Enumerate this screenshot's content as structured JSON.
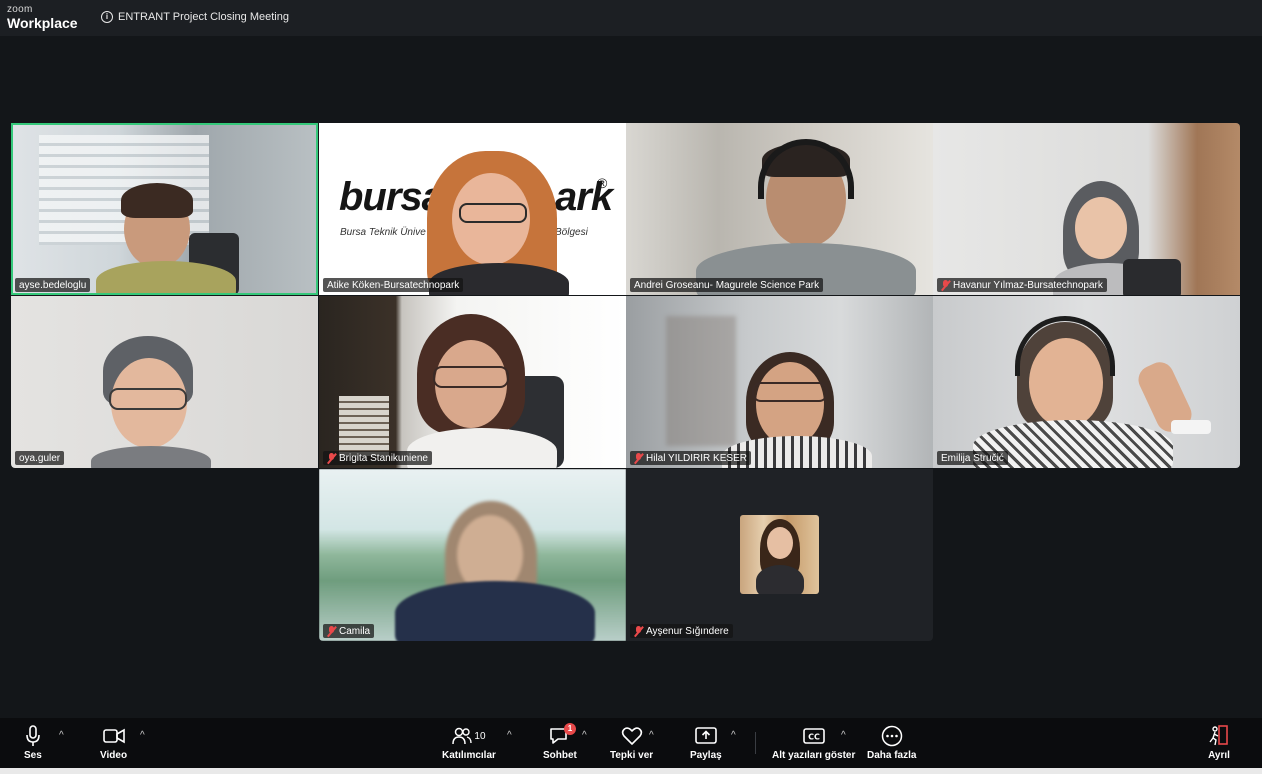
{
  "app": {
    "brand_line1": "zoom",
    "brand_line2": "Workplace"
  },
  "meeting": {
    "title": "ENTRANT Project Closing Meeting"
  },
  "participants": [
    {
      "name": "ayse.bedeloglu",
      "muted": false,
      "active_speaker": true
    },
    {
      "name": "Atike Köken-Bursatechnopark",
      "muted": false,
      "active_speaker": false
    },
    {
      "name": "Andrei Groseanu- Magurele Science Park",
      "muted": false,
      "active_speaker": false
    },
    {
      "name": "Havanur Yılmaz-Bursatechnopark",
      "muted": true,
      "active_speaker": false
    },
    {
      "name": "oya.guler",
      "muted": false,
      "active_speaker": false
    },
    {
      "name": "Brigita Stanikuniene",
      "muted": true,
      "active_speaker": false
    },
    {
      "name": "Hilal YILDIRIR KESER",
      "muted": true,
      "active_speaker": false
    },
    {
      "name": "Emilija Stručić",
      "muted": false,
      "active_speaker": false
    },
    {
      "name": "Camila",
      "muted": true,
      "active_speaker": false
    },
    {
      "name": "Ayşenur Sığındere",
      "muted": true,
      "active_speaker": false
    }
  ],
  "background_logo": {
    "text": "bursat",
    "text2": "ark",
    "tagline1": "Bursa Teknik Ünive",
    "tagline2": "Bölgesi",
    "reg": "®"
  },
  "toolbar": {
    "audio_label": "Ses",
    "video_label": "Video",
    "participants_label": "Katılımcılar",
    "participants_count": "10",
    "chat_label": "Sohbet",
    "chat_badge": "1",
    "react_label": "Tepki ver",
    "share_label": "Paylaş",
    "captions_label": "Alt yazıları göster",
    "more_label": "Daha fazla",
    "leave_label": "Ayrıl",
    "caret": "^"
  },
  "colors": {
    "active_speaker": "#35c87a",
    "mute": "#e8494a",
    "background": "#131619"
  }
}
